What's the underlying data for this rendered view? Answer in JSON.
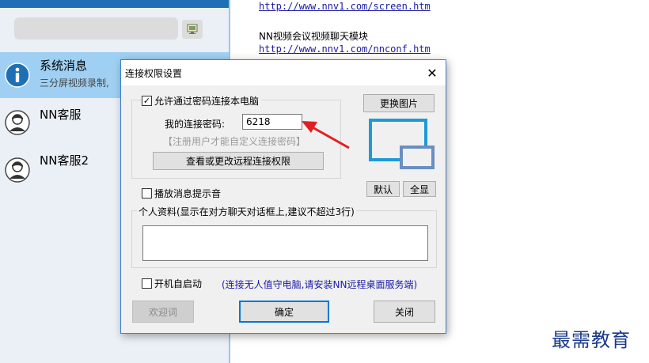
{
  "sidebar": {
    "contacts": [
      {
        "name": "系统消息",
        "preview": "三分屏视频录制,",
        "selected": true
      },
      {
        "name": "NN客服",
        "preview": ""
      },
      {
        "name": "NN客服2",
        "preview": ""
      }
    ]
  },
  "chat": {
    "link1": "http://www.nnv1.com/screen.htm",
    "text1": "NN视频会议视频聊天模块",
    "link2": "http://www.nnv1.com/nnconf.htm"
  },
  "dialog": {
    "title": "连接权限设置",
    "allow_password_label": "允许通过密码连接本电脑",
    "allow_password_checked": true,
    "password_label": "我的连接密码:",
    "password_value": "6218",
    "password_hint": "【注册用户才能自定义连接密码】",
    "view_permissions_button": "查看或更改远程连接权限",
    "change_image_button": "更换图片",
    "default_button": "默认",
    "fullscreen_button": "全显",
    "play_sound_label": "播放消息提示音",
    "play_sound_checked": false,
    "profile_label": "个人资料(显示在对方聊天对话框上,建议不超过3行)",
    "profile_value": "",
    "autostart_label": "开机自启动",
    "autostart_checked": false,
    "autostart_note": "(连接无人值守电脑,请安装NN远程桌面服务端)",
    "welcome_button": "欢迎词",
    "ok_button": "确定",
    "close_button": "关闭"
  },
  "watermark": "最需教育",
  "colors": {
    "accent": "#1e6fb8",
    "selected_row": "#9fd0f3",
    "arrow": "#e02020",
    "link": "#1a1aa8"
  }
}
